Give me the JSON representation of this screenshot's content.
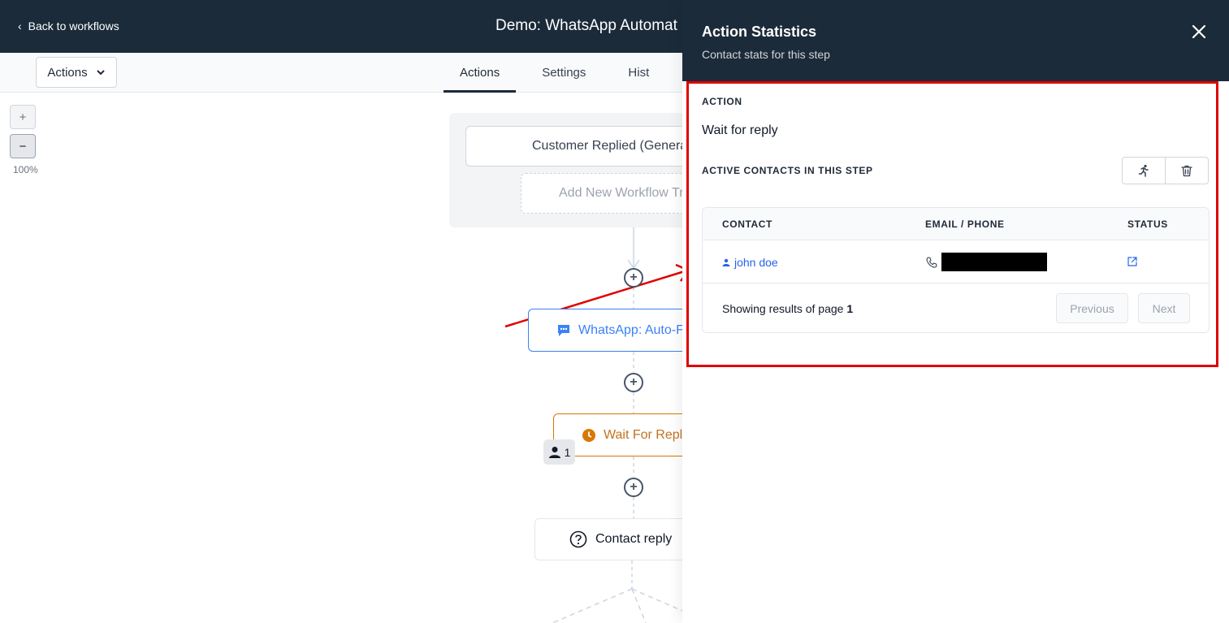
{
  "header": {
    "back_label": "Back to workflows",
    "workflow_title": "Demo: WhatsApp Automat"
  },
  "toolbar": {
    "actions_dropdown": "Actions",
    "tabs": [
      {
        "label": "Actions",
        "active": true
      },
      {
        "label": "Settings",
        "active": false
      },
      {
        "label": "Hist",
        "active": false
      }
    ]
  },
  "zoom": {
    "plus": "+",
    "minus": "−",
    "level": "100%"
  },
  "canvas": {
    "trigger_label": "Customer Replied (Genera",
    "add_trigger_label": "Add New Workflow Tr",
    "whatsapp_step": "WhatsApp: Auto-F",
    "wait_step": "Wait For Reply",
    "wait_step_contact_count": "1",
    "condition_step": "Contact reply",
    "add_step_symbol": "+"
  },
  "panel": {
    "title": "Action Statistics",
    "subtitle": "Contact stats for this step",
    "action_label": "ACTION",
    "action_value": "Wait for reply",
    "active_label": "ACTIVE CONTACTS IN THIS STEP",
    "table": {
      "headers": [
        "CONTACT",
        "EMAIL / PHONE",
        "STATUS"
      ],
      "rows": [
        {
          "contact": "john doe"
        }
      ]
    },
    "pagination": {
      "showing_prefix": "Showing results of page",
      "page": "1",
      "previous": "Previous",
      "next": "Next"
    }
  },
  "colors": {
    "header_bg": "#1b2b3a",
    "link_blue": "#2563eb",
    "whatsapp_blue": "#3b82f6",
    "wait_orange": "#d97706",
    "highlight_red": "#e00000"
  }
}
